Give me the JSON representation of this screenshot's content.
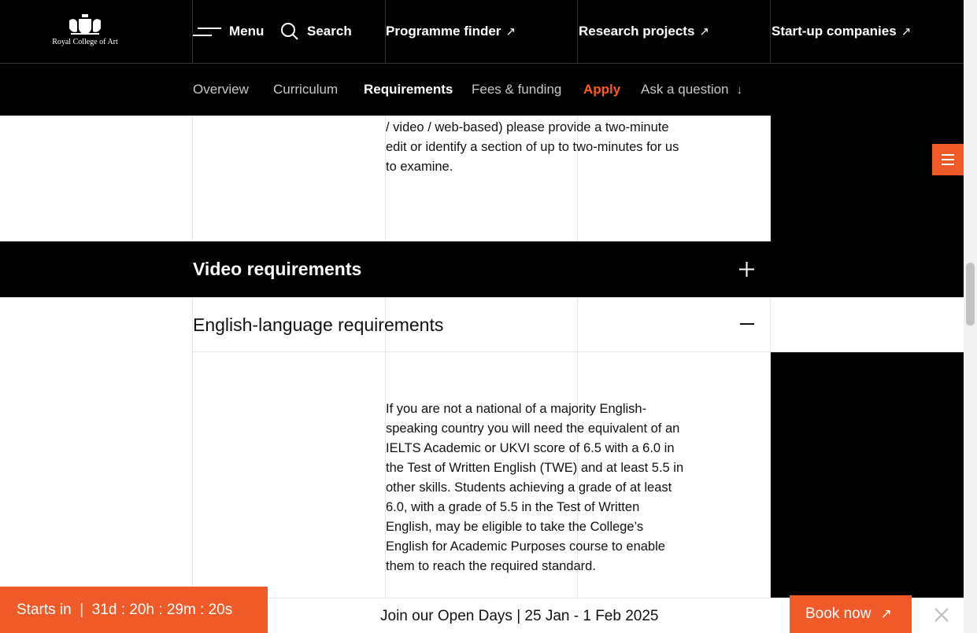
{
  "brand": {
    "name": "Royal College of Art"
  },
  "header": {
    "menu_label": "Menu",
    "search_label": "Search",
    "links": [
      {
        "label": "Programme finder",
        "icon": "external-arrow-icon"
      },
      {
        "label": "Research projects",
        "icon": "external-arrow-icon"
      },
      {
        "label": "Start-up companies",
        "icon": "external-arrow-icon"
      }
    ]
  },
  "subnav": {
    "tabs": [
      {
        "label": "Overview"
      },
      {
        "label": "Curriculum"
      },
      {
        "label": "Requirements",
        "active": true
      },
      {
        "label": "Fees & funding"
      },
      {
        "label": "Apply"
      },
      {
        "label": "Ask a question",
        "icon": "down-arrow-icon"
      }
    ]
  },
  "content": {
    "top_paragraph": "/ video / web-based) please provide a two-minute edit or identify a section of up to two-minutes for us to examine.",
    "sections": [
      {
        "title": "Video requirements",
        "expanded": false,
        "icon": "plus-icon"
      },
      {
        "title": "English-language requirements",
        "expanded": true,
        "icon": "minus-icon",
        "body": "If you are not a national of a majority English-speaking country you will need the equivalent of an IELTS Academic or UKVI score of 6.5 with a 6.0 in the Test of Written English (TWE) and at least 5.5 in other skills. Students achieving a grade of at least 6.0, with a grade of 5.5 in the Test of Written English, may be eligible to take the College’s English for Academic Purposes course to enable them to reach the required standard."
      }
    ]
  },
  "banner": {
    "countdown": "Starts in  |  31d : 20h : 29m : 20s",
    "message": "Join our Open Days | 25 Jan - 1 Feb 2025",
    "book_label": "Book now",
    "book_icon": "external-arrow-icon"
  },
  "colors": {
    "accent": "#f05a28",
    "apply": "#ff5a1f",
    "black": "#000000"
  }
}
